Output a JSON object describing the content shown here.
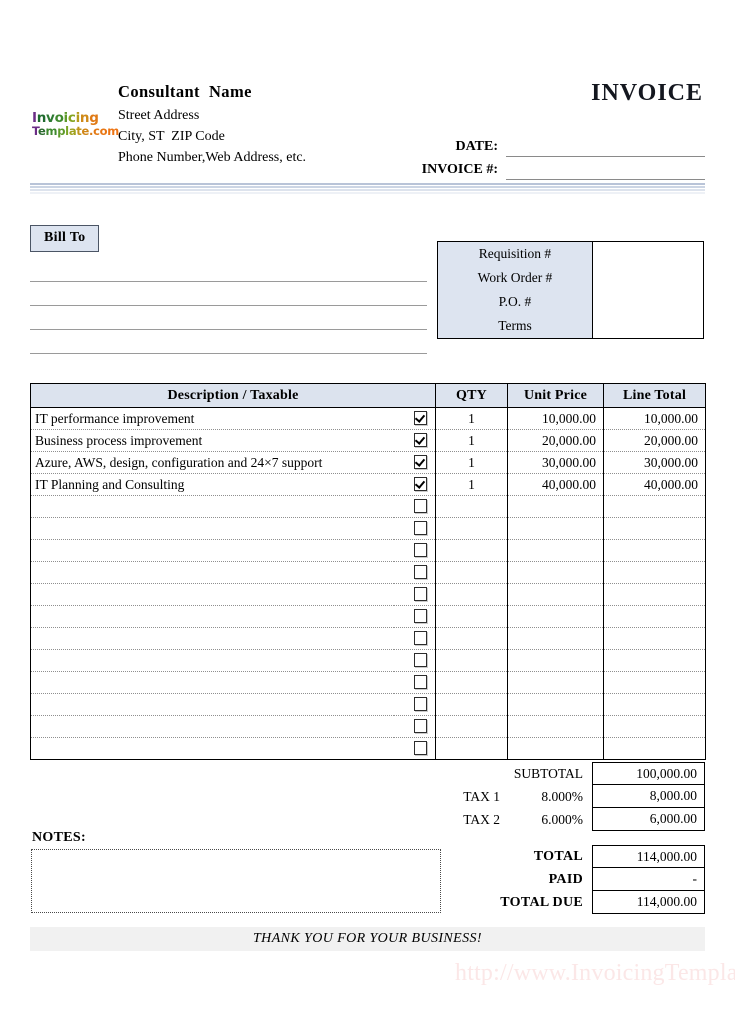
{
  "header": {
    "logo_line1": [
      {
        "t": "I",
        "c": "#6b2d86"
      },
      {
        "t": "n",
        "c": "#1f6b2e"
      },
      {
        "t": "v",
        "c": "#2d7a33"
      },
      {
        "t": "o",
        "c": "#3f8a2f"
      },
      {
        "t": "i",
        "c": "#5d9a2a"
      },
      {
        "t": "c",
        "c": "#86a522"
      },
      {
        "t": "i",
        "c": "#b59b1b"
      },
      {
        "t": "n",
        "c": "#cf8a18"
      },
      {
        "t": "g",
        "c": "#e07a15"
      }
    ],
    "logo_line2": [
      {
        "t": "T",
        "c": "#6b2d86"
      },
      {
        "t": "e",
        "c": "#2d6b30"
      },
      {
        "t": "m",
        "c": "#3f8a2f"
      },
      {
        "t": "p",
        "c": "#5d9a2a"
      },
      {
        "t": "l",
        "c": "#7aa526"
      },
      {
        "t": "a",
        "c": "#a0a21e"
      },
      {
        "t": "t",
        "c": "#bf941a"
      },
      {
        "t": "e",
        "c": "#d08617"
      },
      {
        "t": ".",
        "c": "#dd7c15"
      },
      {
        "t": "c",
        "c": "#e37914"
      },
      {
        "t": "o",
        "c": "#e87613"
      },
      {
        "t": "m",
        "c": "#ed7312"
      }
    ],
    "company_name": "Consultant  Name",
    "address_line1": "Street Address",
    "address_line2": "City, ST  ZIP Code",
    "address_line3": "Phone Number,Web Address, etc.",
    "invoice_title": "INVOICE",
    "date_label": "DATE:",
    "date_value": "",
    "invoice_no_label": "INVOICE #:",
    "invoice_no_value": ""
  },
  "bill_to": {
    "tab_label": "Bill To",
    "lines": [
      "",
      "",
      "",
      ""
    ]
  },
  "requisition": {
    "labels": [
      "Requisition #",
      "Work Order #",
      "P.O. #",
      "Terms"
    ],
    "values": [
      "",
      "",
      "",
      ""
    ]
  },
  "items_table": {
    "columns": [
      "Description / Taxable",
      "QTY",
      "Unit Price",
      "Line Total"
    ],
    "rows": [
      {
        "description": "IT performance improvement",
        "taxable": true,
        "qty": "1",
        "unit_price": "10,000.00",
        "line_total": "10,000.00"
      },
      {
        "description": "Business process improvement",
        "taxable": true,
        "qty": "1",
        "unit_price": "20,000.00",
        "line_total": "20,000.00"
      },
      {
        "description": "Azure, AWS, design, configuration and 24×7 support",
        "taxable": true,
        "qty": "1",
        "unit_price": "30,000.00",
        "line_total": "30,000.00"
      },
      {
        "description": "IT Planning and Consulting",
        "taxable": true,
        "qty": "1",
        "unit_price": "40,000.00",
        "line_total": "40,000.00"
      },
      {
        "description": "",
        "taxable": false,
        "qty": "",
        "unit_price": "",
        "line_total": ""
      },
      {
        "description": "",
        "taxable": false,
        "qty": "",
        "unit_price": "",
        "line_total": ""
      },
      {
        "description": "",
        "taxable": false,
        "qty": "",
        "unit_price": "",
        "line_total": ""
      },
      {
        "description": "",
        "taxable": false,
        "qty": "",
        "unit_price": "",
        "line_total": ""
      },
      {
        "description": "",
        "taxable": false,
        "qty": "",
        "unit_price": "",
        "line_total": ""
      },
      {
        "description": "",
        "taxable": false,
        "qty": "",
        "unit_price": "",
        "line_total": ""
      },
      {
        "description": "",
        "taxable": false,
        "qty": "",
        "unit_price": "",
        "line_total": ""
      },
      {
        "description": "",
        "taxable": false,
        "qty": "",
        "unit_price": "",
        "line_total": ""
      },
      {
        "description": "",
        "taxable": false,
        "qty": "",
        "unit_price": "",
        "line_total": ""
      },
      {
        "description": "",
        "taxable": false,
        "qty": "",
        "unit_price": "",
        "line_total": ""
      },
      {
        "description": "",
        "taxable": false,
        "qty": "",
        "unit_price": "",
        "line_total": ""
      },
      {
        "description": "",
        "taxable": false,
        "qty": "",
        "unit_price": "",
        "line_total": ""
      }
    ]
  },
  "totals": {
    "subtotal_label": "SUBTOTAL",
    "subtotal_value": "100,000.00",
    "tax1_label": "TAX 1",
    "tax1_rate": "8.000%",
    "tax1_value": "8,000.00",
    "tax2_label": "TAX 2",
    "tax2_rate": "6.000%",
    "tax2_value": "6,000.00",
    "total_label": "TOTAL",
    "total_value": "114,000.00",
    "paid_label": "PAID",
    "paid_value": "-",
    "total_due_label": "TOTAL DUE",
    "total_due_value": "114,000.00"
  },
  "notes": {
    "label": "NOTES:",
    "value": ""
  },
  "footer": {
    "thank_you": "THANK YOU FOR YOUR BUSINESS!",
    "watermark": "http://www.InvoicingTemplate.com"
  }
}
